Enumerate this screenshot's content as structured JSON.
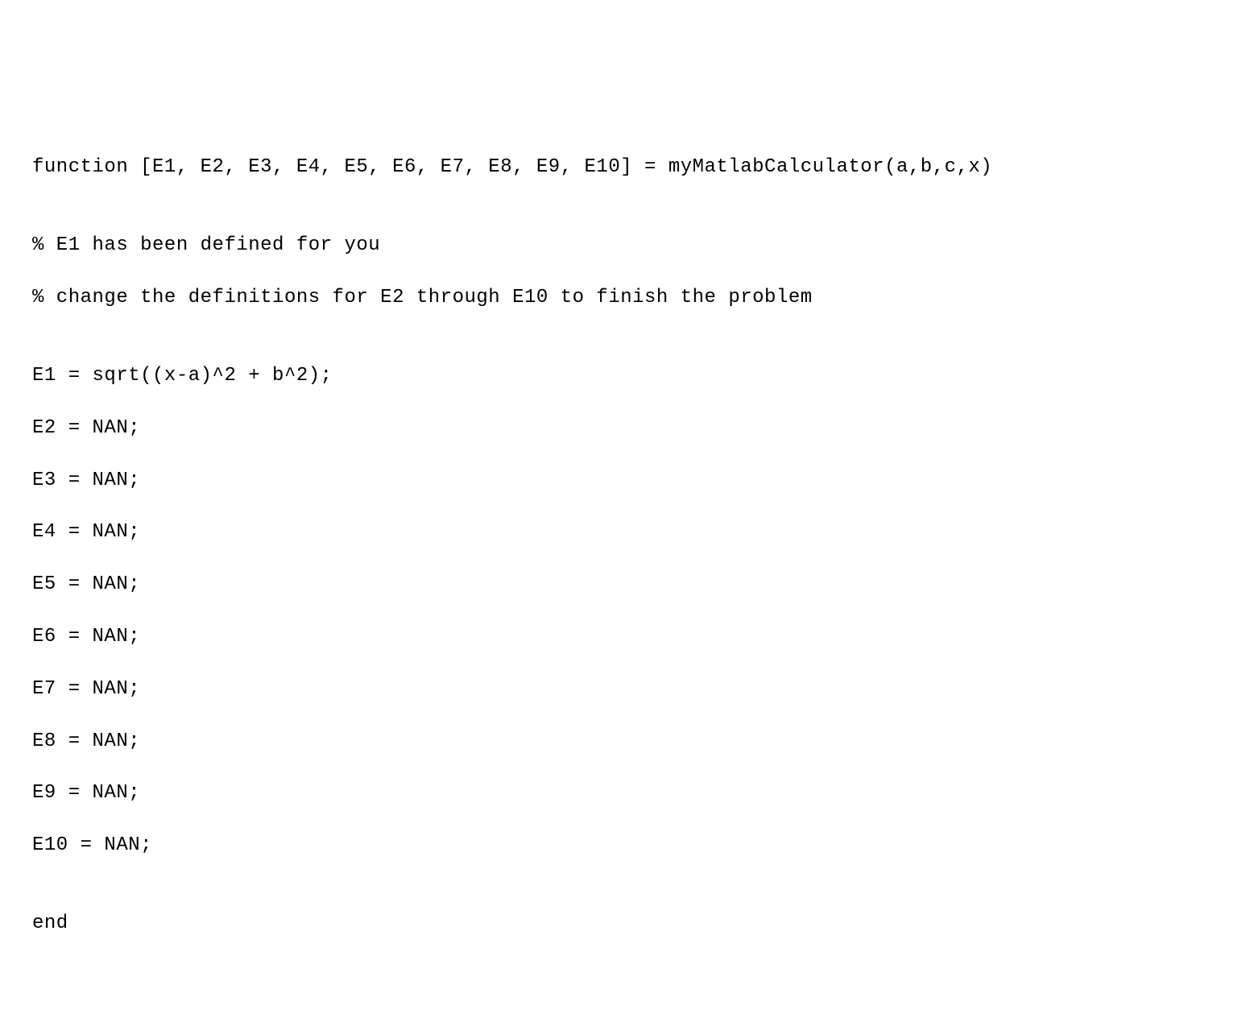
{
  "code": {
    "lines": [
      "function [E1, E2, E3, E4, E5, E6, E7, E8, E9, E10] = myMatlabCalculator(a,b,c,x)",
      "",
      "% E1 has been defined for you",
      "% change the definitions for E2 through E10 to finish the problem",
      "",
      "E1 = sqrt((x-a)^2 + b^2);",
      "E2 = NAN;",
      "E3 = NAN;",
      "E4 = NAN;",
      "E5 = NAN;",
      "E6 = NAN;",
      "E7 = NAN;",
      "E8 = NAN;",
      "E9 = NAN;",
      "E10 = NAN;",
      "",
      "end"
    ]
  }
}
